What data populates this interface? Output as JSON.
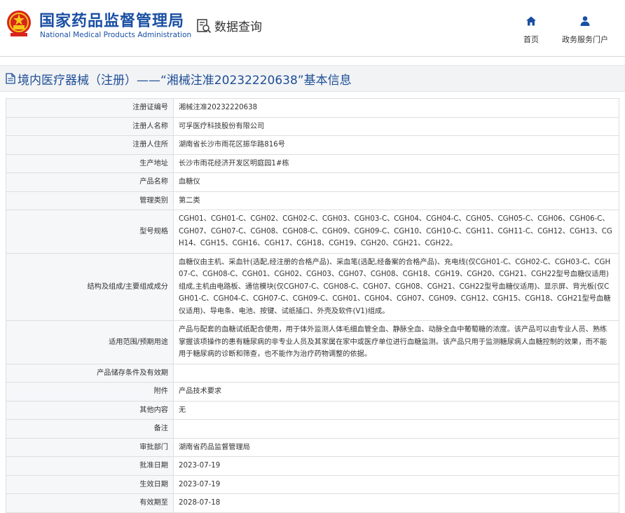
{
  "header": {
    "org_cn": "国家药品监督管理局",
    "org_en": "National Medical Products Administration",
    "section": "数据查询",
    "nav": [
      {
        "label": "首页",
        "icon": "home-icon"
      },
      {
        "label": "政务服务门户",
        "icon": "user-icon"
      }
    ]
  },
  "title": "境内医疗器械（注册）——“湘械注准20232220638”基本信息",
  "colors": {
    "brand": "#1a4fa3",
    "title": "#1d4e96",
    "label_bg": "#f6f7f9",
    "border": "#dedede"
  },
  "rows": [
    {
      "label": "注册证编号",
      "value": "湘械注准20232220638"
    },
    {
      "label": "注册人名称",
      "value": "可孚医疗科技股份有限公司"
    },
    {
      "label": "注册人住所",
      "value": "湖南省长沙市雨花区振华路816号"
    },
    {
      "label": "生产地址",
      "value": "长沙市雨花经济开发区明庭园1#栋"
    },
    {
      "label": "产品名称",
      "value": "血糖仪"
    },
    {
      "label": "管理类别",
      "value": "第二类"
    },
    {
      "label": "型号规格",
      "value": "CGH01、CGH01-C、CGH02、CGH02-C、CGH03、CGH03-C、CGH04、CGH04-C、CGH05、CGH05-C、CGH06、CGH06-C、CGH07、CGH07-C、CGH08、CGH08-C、CGH09、CGH09-C、CGH10、CGH10-C、CGH11、CGH11-C、CGH12、CGH13、CGH14、CGH15、CGH16、CGH17、CGH18、CGH19、CGH20、CGH21、CGH22。"
    },
    {
      "label": "结构及组成/主要组成成分",
      "value": "血糖仪由主机、采血针(选配,经注册的合格产品)、采血笔(选配,经备案的合格产品)、充电线(仅CGH01-C、CGH02-C、CGH03-C、CGH07-C、CGH08-C、CGH01、CGH02、CGH03、CGH07、CGH08、CGH18、CGH19、CGH20、CGH21、CGH22型号血糖仪适用)组成,主机由电路板、通信模块(仅CGH07-C、CGH08-C、CGH07、CGH08、CGH21、CGH22型号血糖仪适用)、显示屏、背光板(仅CGH01-C、CGH04-C、CGH07-C、CGH09-C、CGH01、CGH04、CGH07、CGH09、CGH12、CGH15、CGH18、CGH21型号血糖仪适用)、导电条、电池、按键、试纸插口、外壳及软件(V1)组成。"
    },
    {
      "label": "适用范围/预期用途",
      "value": "产品与配套的血糖试纸配合使用，用于体外监测人体毛细血管全血、静脉全血、动脉全血中葡萄糖的浓度。该产品可以由专业人员、熟练掌握该项操作的患有糖尿病的非专业人员及其家属在家中或医疗单位进行血糖监测。该产品只用于监测糖尿病人血糖控制的效果，而不能用于糖尿病的诊断和筛查，也不能作为治疗药物调整的依据。"
    },
    {
      "label": "产品储存条件及有效期",
      "value": ""
    },
    {
      "label": "附件",
      "value": "产品技术要求"
    },
    {
      "label": "其他内容",
      "value": "无"
    },
    {
      "label": "备注",
      "value": ""
    },
    {
      "label": "审批部门",
      "value": "湖南省药品监督管理局"
    },
    {
      "label": "批准日期",
      "value": "2023-07-19"
    },
    {
      "label": "生效日期",
      "value": "2023-07-19"
    },
    {
      "label": "有效期至",
      "value": "2028-07-18"
    }
  ]
}
